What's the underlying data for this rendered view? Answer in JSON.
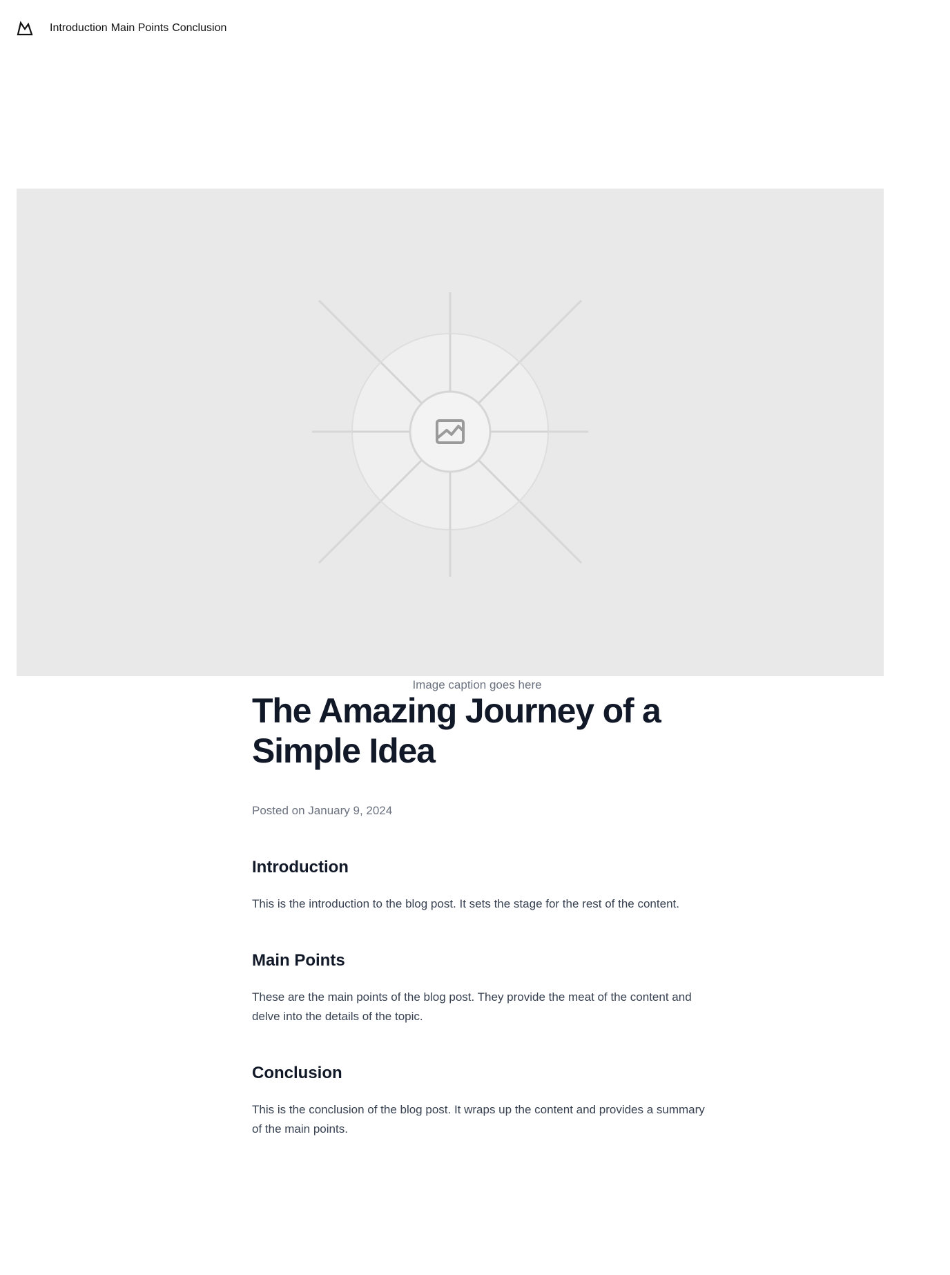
{
  "nav": {
    "logo_icon": "mountain-logo-icon",
    "links": [
      "Introduction",
      "Main Points",
      "Conclusion"
    ]
  },
  "hero": {
    "icon": "image-placeholder-icon",
    "background": "#e9e9e9"
  },
  "caption": "Image caption goes here",
  "article": {
    "title": "The Amazing Journey of a Simple Idea",
    "posted": "Posted on January 9, 2024",
    "sections": [
      {
        "heading": "Introduction",
        "text": "This is the introduction to the blog post. It sets the stage for the rest of the content."
      },
      {
        "heading": "Main Points",
        "text": "These are the main points of the blog post. They provide the meat of the content and delve into the details of the topic."
      },
      {
        "heading": "Conclusion",
        "text": "This is the conclusion of the blog post. It wraps up the content and provides a summary of the main points."
      }
    ]
  },
  "colors": {
    "heading": "#111827",
    "body_text": "#374151",
    "muted": "#6b7280"
  }
}
